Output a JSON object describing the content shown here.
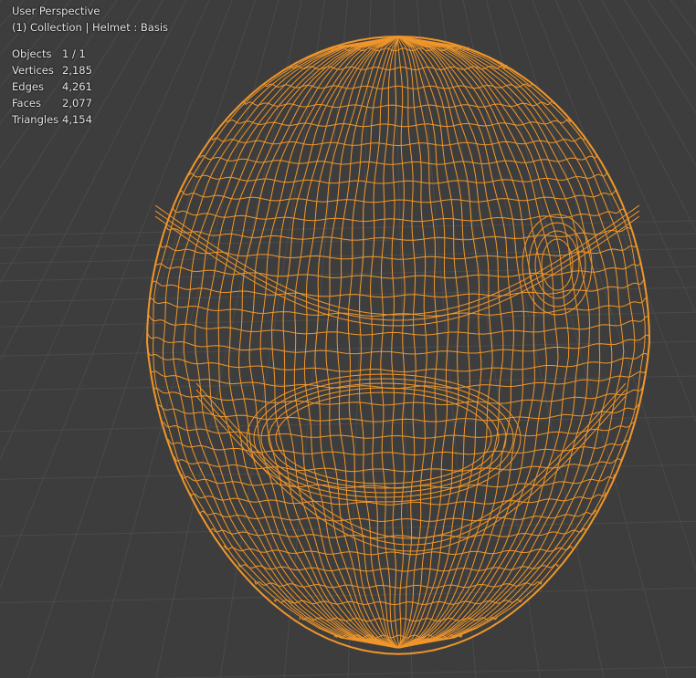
{
  "viewport": {
    "mode_label": "User Perspective",
    "context_label": "(1) Collection | Helmet : Basis"
  },
  "stats": [
    {
      "label": "Objects",
      "value": "1 / 1"
    },
    {
      "label": "Vertices",
      "value": "2,185"
    },
    {
      "label": "Edges",
      "value": "4,261"
    },
    {
      "label": "Faces",
      "value": "2,077"
    },
    {
      "label": "Triangles",
      "value": "4,154"
    }
  ],
  "colors": {
    "background": "#3d3d3d",
    "grid": "#4a4a4a",
    "wire": "#f0962a",
    "text": "#e8e8e8"
  }
}
